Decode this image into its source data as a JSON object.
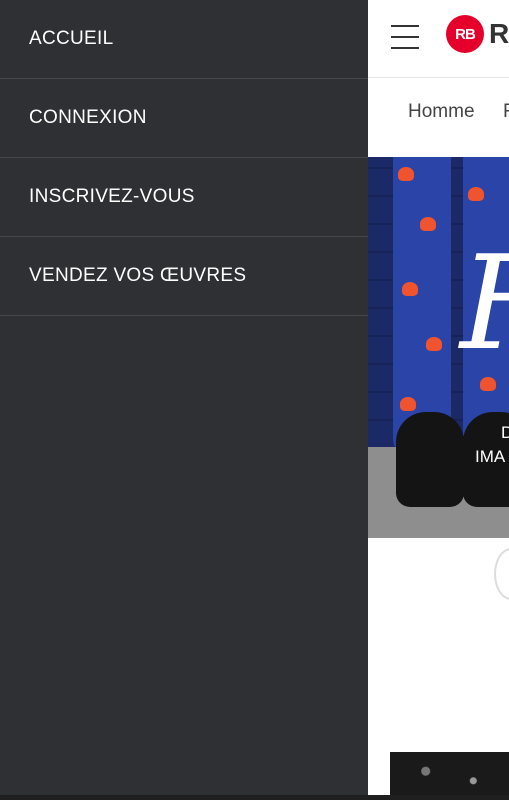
{
  "drawer": {
    "items": [
      {
        "label": "ACCUEIL"
      },
      {
        "label": "CONNEXION"
      },
      {
        "label": "INSCRIVEZ-VOUS"
      },
      {
        "label": "VENDEZ VOS ŒUVRES"
      }
    ]
  },
  "header": {
    "logo_mark": "RB",
    "logo_text": "RI",
    "menu_icon": "hamburger-icon"
  },
  "category_nav": {
    "items": [
      {
        "label": "Homme"
      },
      {
        "label": "F"
      }
    ]
  },
  "hero": {
    "script_glyph": "F",
    "line1": "D",
    "line2": "IMA"
  },
  "colors": {
    "drawer_bg": "#2f3034",
    "brand_red": "#e4002b",
    "divider": "#46474b"
  }
}
